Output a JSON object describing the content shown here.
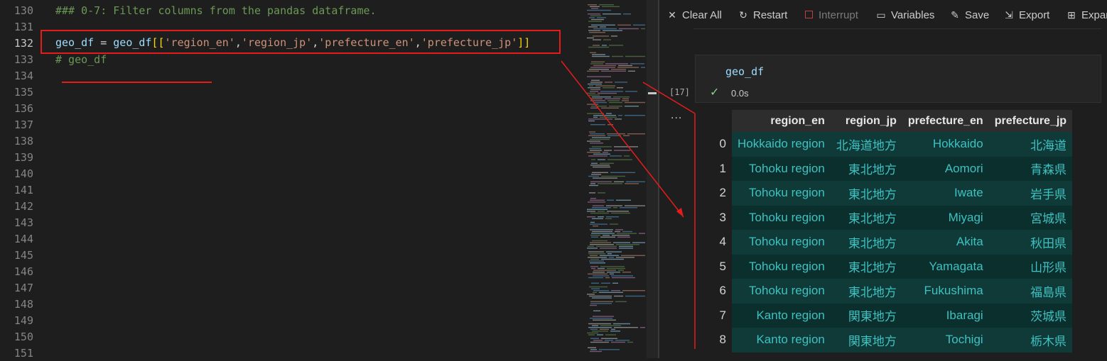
{
  "editor": {
    "lines": [
      {
        "num": "130",
        "text": "### 0-7: Filter columns from the pandas dataframe."
      },
      {
        "num": "131",
        "text": ""
      },
      {
        "num": "132",
        "text": ""
      },
      {
        "num": "133",
        "text": "# geo_df"
      },
      {
        "num": "134",
        "text": ""
      },
      {
        "num": "135",
        "text": ""
      },
      {
        "num": "136",
        "text": ""
      },
      {
        "num": "137",
        "text": ""
      },
      {
        "num": "138",
        "text": ""
      },
      {
        "num": "139",
        "text": ""
      },
      {
        "num": "140",
        "text": ""
      },
      {
        "num": "141",
        "text": ""
      },
      {
        "num": "142",
        "text": ""
      },
      {
        "num": "143",
        "text": ""
      },
      {
        "num": "144",
        "text": ""
      },
      {
        "num": "145",
        "text": ""
      },
      {
        "num": "146",
        "text": ""
      },
      {
        "num": "147",
        "text": ""
      },
      {
        "num": "148",
        "text": ""
      },
      {
        "num": "149",
        "text": ""
      },
      {
        "num": "150",
        "text": ""
      },
      {
        "num": "151",
        "text": ""
      }
    ],
    "code_line": {
      "var1": "geo_df",
      "eq": " = ",
      "var2": "geo_df",
      "open": "[[",
      "s1": "'region_en'",
      "c1": ",",
      "s2": "'region_jp'",
      "c2": ",",
      "s3": "'prefecture_en'",
      "c3": ",",
      "s4": "'prefecture_jp'",
      "close": "]]"
    }
  },
  "toolbar": {
    "clear_all": "Clear All",
    "restart": "Restart",
    "interrupt": "Interrupt",
    "variables": "Variables",
    "save": "Save",
    "export": "Export",
    "expand": "Expand"
  },
  "cell": {
    "code": "geo_df",
    "exec_count": "[17]",
    "time": "0.0s",
    "more": "..."
  },
  "table": {
    "columns": [
      "region_en",
      "region_jp",
      "prefecture_en",
      "prefecture_jp"
    ],
    "rows": [
      {
        "idx": "0",
        "cells": [
          "Hokkaido region",
          "北海道地方",
          "Hokkaido",
          "北海道"
        ]
      },
      {
        "idx": "1",
        "cells": [
          "Tohoku region",
          "東北地方",
          "Aomori",
          "青森県"
        ]
      },
      {
        "idx": "2",
        "cells": [
          "Tohoku region",
          "東北地方",
          "Iwate",
          "岩手県"
        ]
      },
      {
        "idx": "3",
        "cells": [
          "Tohoku region",
          "東北地方",
          "Miyagi",
          "宮城県"
        ]
      },
      {
        "idx": "4",
        "cells": [
          "Tohoku region",
          "東北地方",
          "Akita",
          "秋田県"
        ]
      },
      {
        "idx": "5",
        "cells": [
          "Tohoku region",
          "東北地方",
          "Yamagata",
          "山形県"
        ]
      },
      {
        "idx": "6",
        "cells": [
          "Tohoku region",
          "東北地方",
          "Fukushima",
          "福島県"
        ]
      },
      {
        "idx": "7",
        "cells": [
          "Kanto region",
          "関東地方",
          "Ibaragi",
          "茨城県"
        ]
      },
      {
        "idx": "8",
        "cells": [
          "Kanto region",
          "関東地方",
          "Tochigi",
          "栃木県"
        ]
      }
    ]
  },
  "colors": {
    "annotation": "#e51c1c",
    "table_text": "#3ec1c1",
    "comment": "#6a9955",
    "string": "#ce9178"
  },
  "icons": {
    "clear_all": "close-icon",
    "restart": "restart-icon",
    "interrupt": "stop-icon",
    "variables": "variables-icon",
    "save": "save-icon",
    "export": "export-icon",
    "expand": "expand-icon",
    "check": "check-icon"
  }
}
